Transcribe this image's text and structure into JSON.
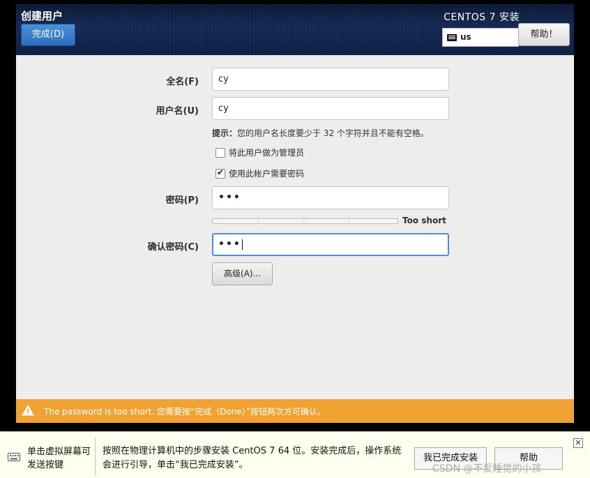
{
  "header": {
    "page_title": "创建用户",
    "done_label": "完成(D)",
    "product_title": "CENTOS 7 安装",
    "keyboard_layout": "us",
    "help_label": "帮助！",
    "accent_color": "#2c6fbd"
  },
  "form": {
    "fullname": {
      "label": "全名(F)",
      "value": "cy"
    },
    "username": {
      "label": "用户名(U)",
      "value": "cy"
    },
    "hint": {
      "label": "提示：",
      "text": "您的用户名长度要少于 32 个字符并且不能有空格。"
    },
    "make_admin": {
      "label": "将此用户做为管理员",
      "checked": false
    },
    "require_password": {
      "label": "使用此帐户需要密码",
      "checked": true
    },
    "password": {
      "label": "密码(P)",
      "value": "•••"
    },
    "strength": {
      "text": "Too short",
      "level": 0,
      "segments": 4
    },
    "confirm_password": {
      "label": "确认密码(C)",
      "value": "•••"
    },
    "advanced_label": "高级(A)..."
  },
  "warning": {
    "text": "The password is too short. 您需要按“完成（Done）”按钮两次方可确认。",
    "color": "#f0a232"
  },
  "tip_bar": {
    "vm_hint": "单击虚拟屏幕可发送按键",
    "text": "按照在物理计算机中的步骤安装 CentOS 7 64 位。安装完成后，操作系统会进行引导，单击“我已完成安装”。",
    "finished_label": "我已完成安装",
    "help_label": "帮助",
    "close_label": "✕",
    "watermark": "CSDN @不爱睡觉的小孩"
  }
}
